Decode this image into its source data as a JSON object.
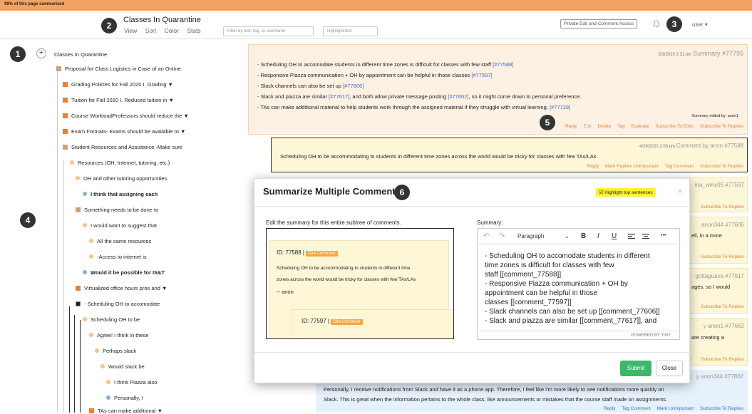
{
  "banner": "99% of this page summarized",
  "header": {
    "title": "Classes In Quarantine",
    "nav": [
      "View",
      "Sort",
      "Color",
      "Stats"
    ],
    "filter_placeholder": "Filter by text, tag, or username",
    "highlight_placeholder": "Highlight text",
    "access_button": "Private Edit and Comment Access",
    "user": "user ▾"
  },
  "markers": [
    "1",
    "2",
    "3",
    "4",
    "5",
    "6"
  ],
  "tree": {
    "root": "Classes In Quarantine",
    "plus": "+",
    "items": [
      "Proposal for Class Logistics in Case of an Online",
      "Grading Policies for Fall 2020 I. Grading ▼",
      "Tuition for Fall 2020 I. Reduced tuition in ▼",
      "Course WorkloadProfessors should reduce the ▼",
      "Exam Formats- Exams should be available to ▼",
      "Student Resources and Assistance -Make sure",
      "Resources (OH, Internet, tutoring, etc.)",
      "OH and other tutoring opportunities",
      "I think that assigning each",
      "Something needs to be done to",
      "I would want to suggest that",
      "All the same resources",
      "-Access to internet is",
      "Would it be possible for IS&T",
      "Virtualized office hours pros and ▼",
      "- Scheduling OH to accomodate",
      "Scheduling OH to be",
      "Agree! I think in these",
      "Perhaps slack",
      "Would slack be",
      "I think Piazza also",
      "Personally, I",
      "TAs can make additional ▼"
    ]
  },
  "summary": {
    "date": "5/3/2020 2:31 pm",
    "label": "Summary #77795",
    "lines": [
      {
        "text": "- Scheduling OH to accomodate students in different time zones is difficult for classes with few staff ",
        "links": [
          "[#77588]"
        ]
      },
      {
        "text": "- Responsive Piazza communication + OH by appointment can be helpful in those classes ",
        "links": [
          "[#77597]"
        ]
      },
      {
        "text": "- Slack channels can also be set up ",
        "links": [
          "[#77606]"
        ]
      },
      {
        "text": "- Slack and piazza are similar ",
        "links": [
          "[#77617]",
          "[#77662]"
        ],
        "mid": ", and both allow private message posting ",
        "tail": ", so it might come down to personal preference."
      },
      {
        "text": "- TAs can make additional material to help students work through the assigned material if they struggle with virtual learning. ",
        "links": [
          "[#77729]"
        ]
      }
    ],
    "edited_by": "Summary edited by: anon1",
    "actions": [
      "Reply",
      "Edit",
      "Delete",
      "Tag",
      "Evaluate",
      "Subscribe To Edits",
      "Subscribe To Replies"
    ]
  },
  "comment": {
    "date": "4/29/2020 2:59 pm",
    "label": "Comment by anon #77588",
    "text": "Scheduling OH to be accommodating to students in different time zones across the world would be tricky for classes with few TAs/LAs",
    "actions": [
      "Reply",
      "Mark Replies Unimportant",
      "Tag Comment",
      "Subscribe To Replies"
    ]
  },
  "side_comments": [
    {
      "meta": "ina_wmy05 #77597",
      "text": "",
      "action": "Subscribe To Replies"
    },
    {
      "meta": "anon344 #77606",
      "text": "ell, in a more",
      "action": "Subscribe To Replies"
    },
    {
      "meta": "gottaguava #77617",
      "text": "ages, so I would",
      "action": "Subscribe To Replies"
    },
    {
      "meta": "y anon1 #77662",
      "text": "are creating a",
      "action": "Subscribe To Replies"
    }
  ],
  "bottom_comment": {
    "meta": "y anon344 #77802",
    "line1": "Personally, I receive notifications from Slack and have it as a phone app. Therefore, I feel like I'm more likely to see notifications more quickly on",
    "line2": "Slack. This is great when the information pertains to the whole class, like announcements or mistakes that the course staff made on assignments.",
    "actions": [
      "Reply",
      "Tag Comment",
      "Mark Unimportant",
      "Subscribe To Replies"
    ]
  },
  "modal": {
    "title": "Summarize Multiple Comments",
    "highlight_button": "Highlight top sentences",
    "close": "×",
    "left_label": "Edit the summary for this entire subtree of comments.",
    "right_label": "Summary:",
    "card1": {
      "id": "ID: 77588 |",
      "cite": "Cite Comment",
      "text1": "Scheduling OH to be accommodating to students in different time",
      "text2": "zones across the world would be tricky for classes with few TAs/LAs",
      "author": "-- anon"
    },
    "card2": {
      "id": "ID: 77597 |",
      "cite": "Cite Comment"
    },
    "toolbar": {
      "undo": "↶",
      "redo": "↷",
      "format": "Paragraph",
      "bold": "B",
      "italic": "I",
      "underline": "U",
      "more": "•••"
    },
    "editor_lines": [
      "- Scheduling OH to accomodate students in different",
      "time zones is difficult for classes with few",
      "staff [[comment_77588]]",
      "- Responsive Piazza communication + OH by",
      "appointment can be helpful in those",
      "classes [[comment_77597]]",
      "- Slack channels can also be set up [[comment_77606]]",
      "- Slack and piazza are similar [[comment_77617]], and"
    ],
    "powered": "POWERED BY TINY",
    "submit": "Submit",
    "close_button": "Close"
  },
  "colors": {
    "banner": "#f4a261",
    "summary_bg": "#fdf1e4",
    "comment_bg": "#fdf7d8",
    "link": "#3a6ec8",
    "action": "#e8803a",
    "submit": "#3bb86b"
  }
}
